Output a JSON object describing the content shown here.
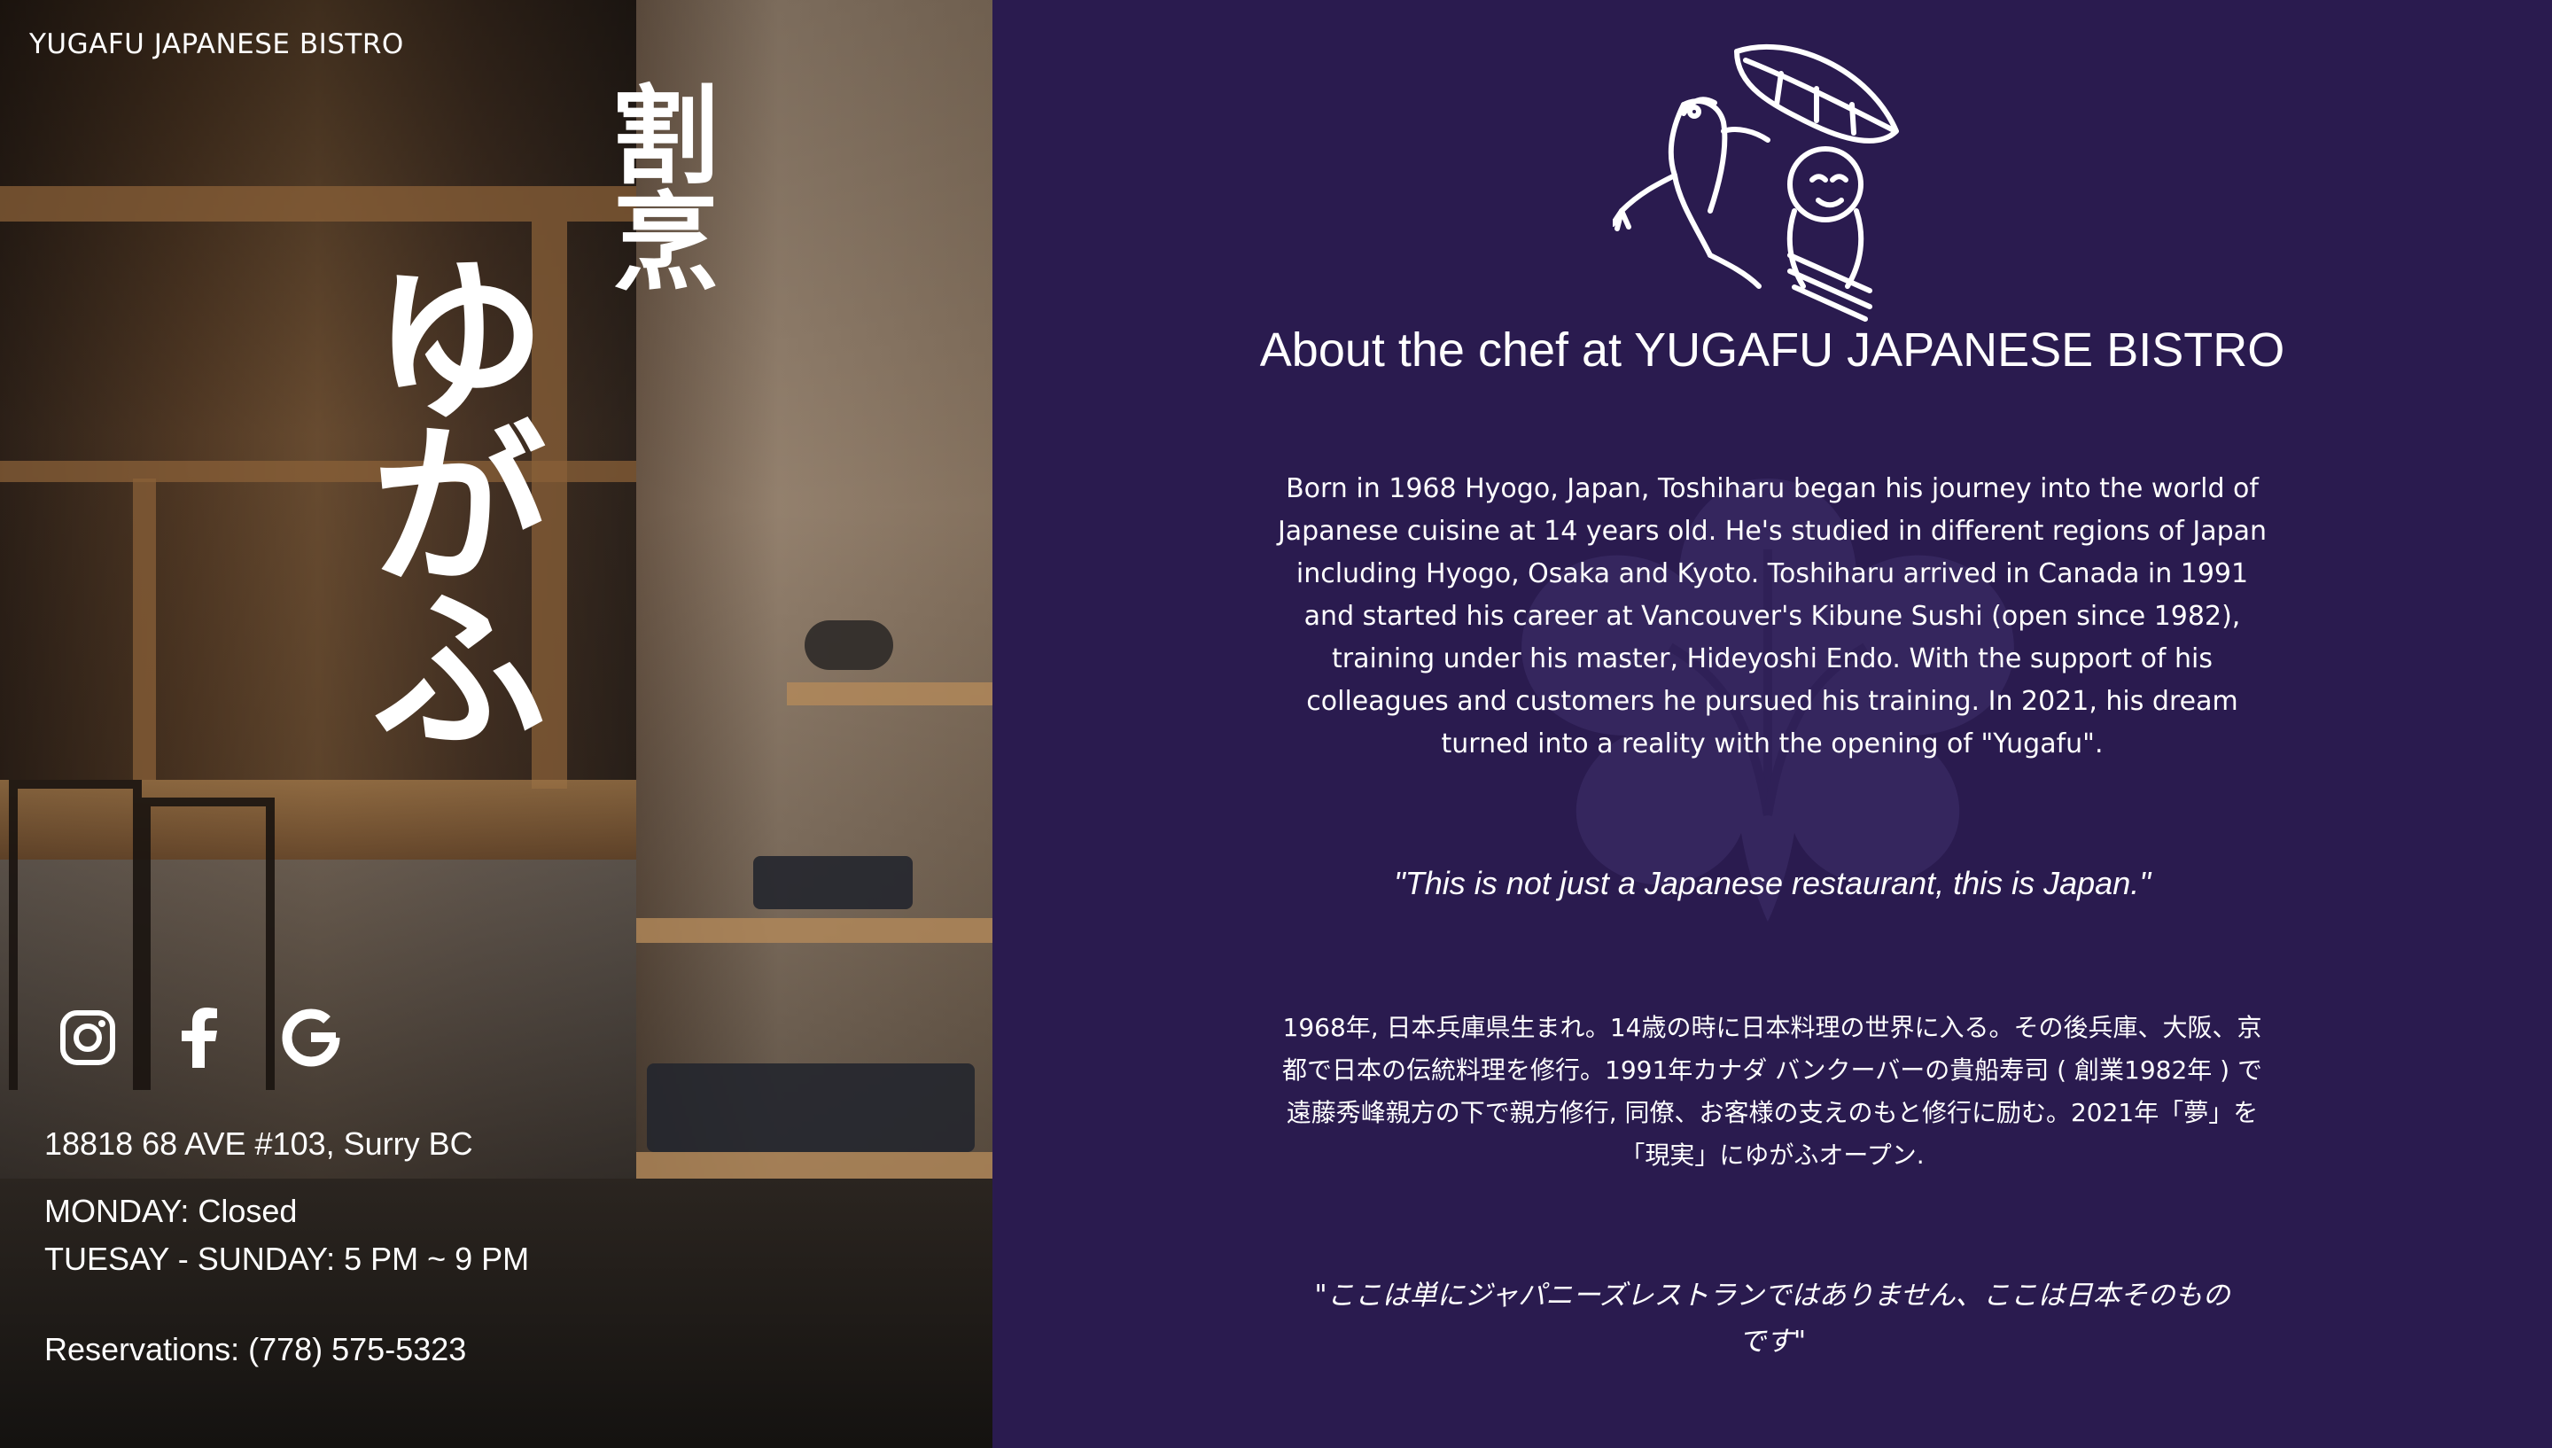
{
  "left_panel": {
    "site_title": "YUGAFU JAPANESE BISTRO",
    "calligraphy_small": "割烹",
    "calligraphy_big": "ゆがふ",
    "social": [
      {
        "name": "instagram-icon",
        "glyph": "instagram"
      },
      {
        "name": "facebook-icon",
        "glyph": "f"
      },
      {
        "name": "google-icon",
        "glyph": "G"
      }
    ],
    "address": "18818 68 AVE #103, Surry BC",
    "hours_monday": "MONDAY: Closed",
    "hours_tue_sun": "TUESAY - SUNDAY: 5 PM ~ 9 PM",
    "reservations": "Reservations: (778) 575-5323"
  },
  "main": {
    "heading": "About the chef at YUGAFU JAPANESE BISTRO",
    "bio_en": "Born in 1968 Hyogo, Japan, Toshiharu began his journey into the world of Japanese cuisine at 14 years old. He's studied in different regions of Japan including Hyogo, Osaka and Kyoto. Toshiharu arrived in Canada in 1991 and started his career at Vancouver's Kibune Sushi (open since 1982), training under his master, Hideyoshi Endo. With the support of his colleagues and customers he pursued his training. In 2021, his dream turned into a reality with the opening of \"Yugafu\".",
    "quote_en": "\"This is not just a Japanese restaurant, this is Japan.\"",
    "bio_jp": "1968年, 日本兵庫県生まれ。14歳の時に日本料理の世界に入る。その後兵庫、大阪、京都で日本の伝統料理を修行。1991年カナダ バンクーバーの貴船寿司 ( 創業1982年 ) で遠藤秀峰親方の下で親方修行, 同僚、お客様の支えのもと修行に励む。2021年「夢」を「現実」にゆがふオープン.",
    "quote_jp": "\"ここは単にジャパニーズレストランではありません、ここは日本そのものです\""
  },
  "colors": {
    "panel_bg": "#2a1b4f",
    "crest": "#3a2a63",
    "text": "#ffffff"
  }
}
